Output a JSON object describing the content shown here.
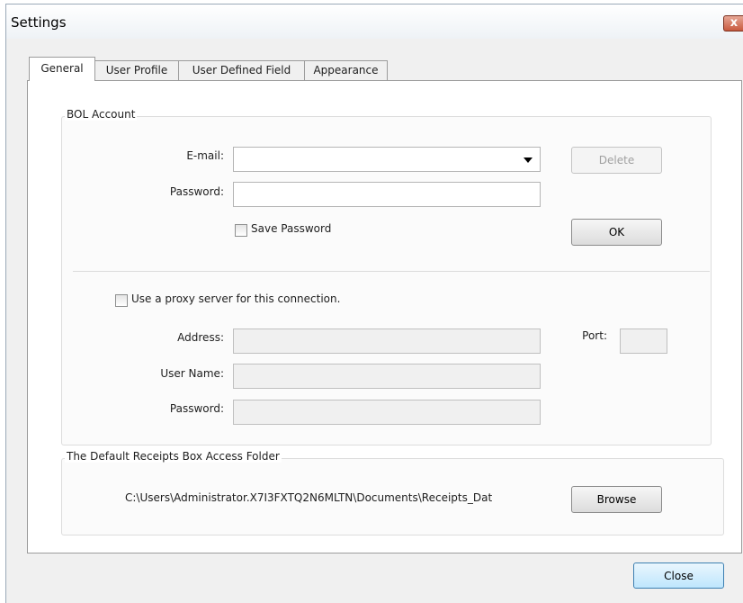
{
  "window": {
    "title": "Settings",
    "close_label": "x"
  },
  "tabs": [
    {
      "label": "General",
      "active": true
    },
    {
      "label": "User Profile",
      "active": false
    },
    {
      "label": "User Defined Field",
      "active": false
    },
    {
      "label": "Appearance",
      "active": false
    }
  ],
  "bol_account": {
    "group_title": "BOL Account",
    "email_label": "E-mail:",
    "email_value": "",
    "password_label": "Password:",
    "password_value": "",
    "save_password_label": "Save Password",
    "save_password_checked": false,
    "delete_label": "Delete",
    "ok_label": "OK"
  },
  "proxy": {
    "use_proxy_label": "Use a proxy server for this connection.",
    "use_proxy_checked": false,
    "address_label": "Address:",
    "port_label": "Port:",
    "username_label": "User Name:",
    "password_label": "Password:"
  },
  "receipts_folder": {
    "group_title": "The Default Receipts Box Access Folder",
    "path": "C:\\Users\\Administrator.X7I3FXTQ2N6MLTN\\Documents\\Receipts_Dat",
    "browse_label": "Browse"
  },
  "footer": {
    "close_label": "Close"
  }
}
